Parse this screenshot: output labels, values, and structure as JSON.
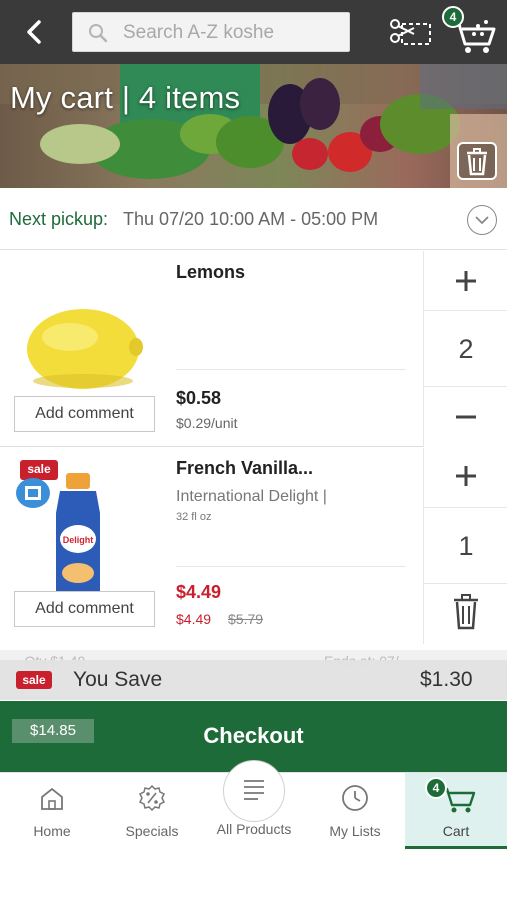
{
  "topbar": {
    "search_placeholder": "Search A-Z koshe",
    "cart_badge": "4"
  },
  "hero": {
    "title": "My cart | 4 items"
  },
  "pickup": {
    "label": "Next pickup:",
    "value": "Thu 07/20 10:00 AM - 05:00 PM"
  },
  "items": [
    {
      "name": "Lemons",
      "price": "$0.58",
      "unit_price": "$0.29/unit",
      "quantity": "2",
      "comment_label": "Add comment",
      "icon": "lemon-image"
    },
    {
      "name": "French Vanilla...",
      "brand": "International Delight |",
      "size": "32 fl oz",
      "price": "$4.49",
      "sale_price": "$4.49",
      "original_price": "$5.79",
      "quantity": "1",
      "comment_label": "Add comment",
      "sale_tag": "sale",
      "icon": "creamer-bottle-image"
    }
  ],
  "faded_row": {
    "left": "- Qty $1.49",
    "right": "Ends at: 07/..."
  },
  "savings": {
    "sale_tag": "sale",
    "label": "You Save",
    "amount": "$1.30"
  },
  "checkout": {
    "total": "$14.85",
    "label": "Checkout"
  },
  "bottom_nav": [
    {
      "label": "Home",
      "icon": "home-icon"
    },
    {
      "label": "Specials",
      "icon": "specials-icon"
    },
    {
      "label": "All Products",
      "icon": "all-products-icon"
    },
    {
      "label": "My Lists",
      "icon": "my-lists-icon"
    },
    {
      "label": "Cart",
      "icon": "cart-icon",
      "badge": "4",
      "active": true
    }
  ],
  "colors": {
    "brand_green": "#1e6b3a",
    "sale_red": "#c8202d",
    "topbar": "#3a3a3a"
  }
}
